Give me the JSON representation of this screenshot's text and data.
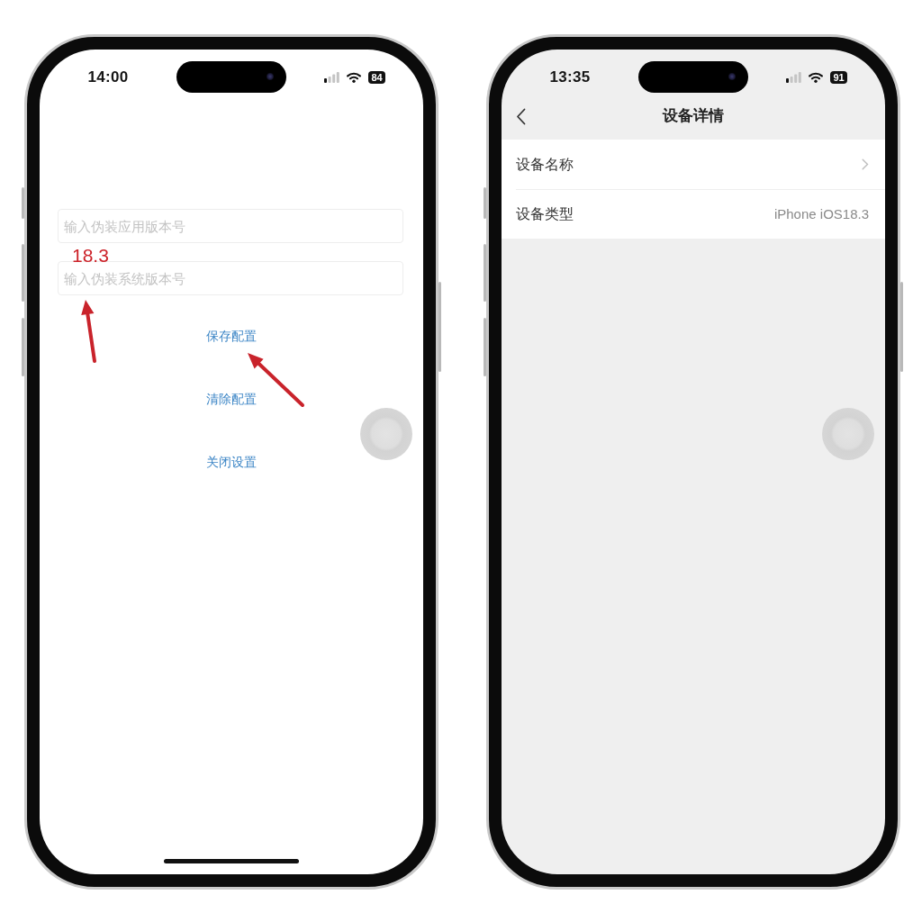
{
  "phones": [
    {
      "kind": "form",
      "status_bar": {
        "time": "14:00",
        "battery": "84"
      },
      "fields": [
        {
          "placeholder": "输入伪装应用版本号"
        },
        {
          "placeholder": "输入伪装系统版本号"
        }
      ],
      "buttons": [
        "保存配置",
        "清除配置",
        "关闭设置"
      ],
      "annotations": [
        {
          "text": "18.3"
        }
      ]
    },
    {
      "kind": "list",
      "status_bar": {
        "time": "13:35",
        "battery": "91"
      },
      "nav_bar": {
        "title": "设备详情"
      },
      "rows": [
        {
          "kind": "disclosure",
          "label": "设备名称"
        },
        {
          "kind": "value",
          "label": "设备类型",
          "value": "iPhone iOS18.3"
        }
      ]
    }
  ]
}
